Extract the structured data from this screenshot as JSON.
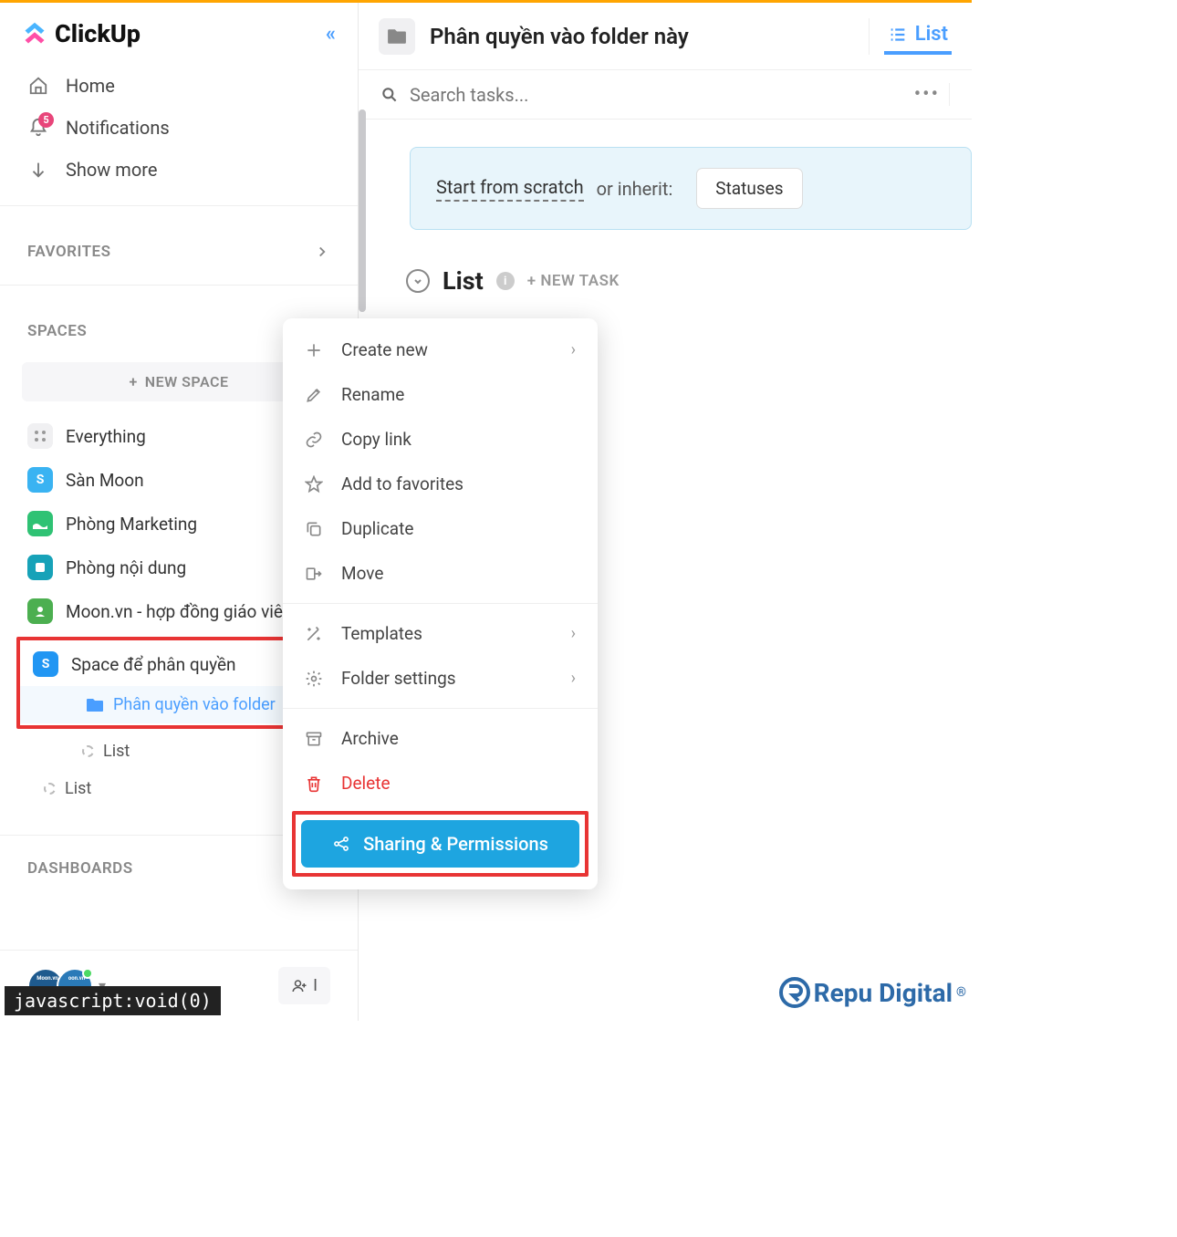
{
  "brand": "ClickUp",
  "nav": {
    "home": "Home",
    "notifications": "Notifications",
    "notif_badge": "5",
    "show_more": "Show more"
  },
  "sections": {
    "favorites": "FAVORITES",
    "spaces": "SPACES",
    "dashboards": "DASHBOARDS"
  },
  "new_space": "NEW SPACE",
  "spaces": {
    "everything": "Everything",
    "s1": "Sàn Moon",
    "s2": "Phòng Marketing",
    "s3": "Phòng nội dung",
    "s4": "Moon.vn - hợp đồng giáo viê",
    "s5": "Space để phân quyền",
    "folder": "Phân quyền vào folder",
    "list1": "List",
    "list2": "List"
  },
  "invite": "I",
  "main": {
    "title": "Phân quyền vào folder này",
    "view_list": "List",
    "search_placeholder": "Search tasks...",
    "start_from_scratch": "Start from scratch",
    "or_inherit": " or inherit:",
    "statuses": "Statuses",
    "list_heading": "List",
    "new_task": "+ NEW TASK"
  },
  "menu": {
    "create_new": "Create new",
    "rename": "Rename",
    "copy_link": "Copy link",
    "add_favorites": "Add to favorites",
    "duplicate": "Duplicate",
    "move": "Move",
    "templates": "Templates",
    "folder_settings": "Folder settings",
    "archive": "Archive",
    "delete": "Delete",
    "sharing": "Sharing & Permissions"
  },
  "watermark": "Repu Digital",
  "js_void": "javascript:void(0)"
}
